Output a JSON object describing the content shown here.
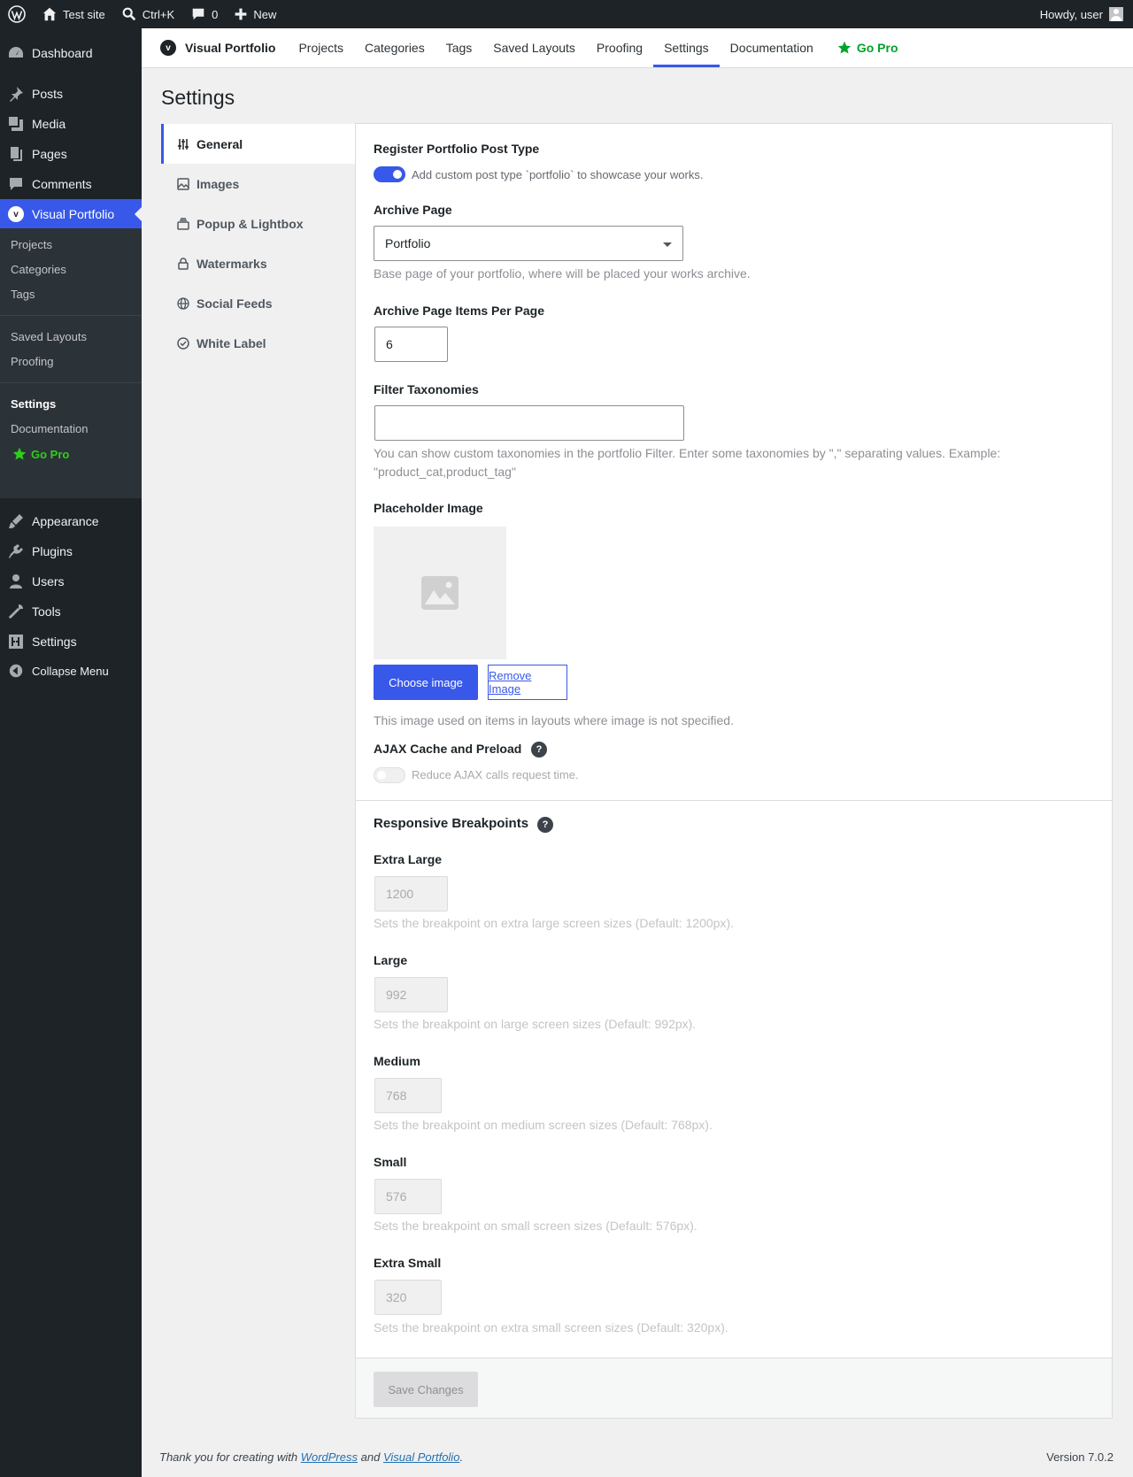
{
  "adminbar": {
    "site_name": "Test site",
    "search_shortcut": "Ctrl+K",
    "comments_count": "0",
    "new_label": "New",
    "howdy": "Howdy, user"
  },
  "menu": {
    "dashboard": "Dashboard",
    "posts": "Posts",
    "media": "Media",
    "pages": "Pages",
    "comments": "Comments",
    "visual_portfolio": "Visual Portfolio",
    "appearance": "Appearance",
    "plugins": "Plugins",
    "users": "Users",
    "tools": "Tools",
    "settings": "Settings",
    "collapse": "Collapse Menu",
    "submenu": {
      "projects": "Projects",
      "categories": "Categories",
      "tags": "Tags",
      "saved_layouts": "Saved Layouts",
      "proofing": "Proofing",
      "settings": "Settings",
      "documentation": "Documentation",
      "go_pro": "Go Pro"
    }
  },
  "header": {
    "brand": "Visual Portfolio",
    "logo_letter": "v",
    "nav": {
      "projects": "Projects",
      "categories": "Categories",
      "tags": "Tags",
      "saved_layouts": "Saved Layouts",
      "proofing": "Proofing",
      "settings": "Settings",
      "documentation": "Documentation",
      "go_pro": "Go Pro"
    }
  },
  "page": {
    "title": "Settings"
  },
  "tabs": {
    "general": "General",
    "images": "Images",
    "popup": "Popup & Lightbox",
    "watermarks": "Watermarks",
    "social": "Social Feeds",
    "white_label": "White Label"
  },
  "general": {
    "register_label": "Register Portfolio Post Type",
    "register_desc": "Add custom post type `portfolio` to showcase your works.",
    "register_enabled": true,
    "archive_label": "Archive Page",
    "archive_value": "Portfolio",
    "archive_desc": "Base page of your portfolio, where will be placed your works archive.",
    "per_page_label": "Archive Page Items Per Page",
    "per_page_value": "6",
    "filter_label": "Filter Taxonomies",
    "filter_value": "",
    "filter_desc_line1": "You can show custom taxonomies in the portfolio Filter. Enter some taxonomies by \",\" separating values. Example:",
    "filter_desc_line2": "\"product_cat,product_tag\"",
    "placeholder_label": "Placeholder Image",
    "choose_image": "Choose image",
    "remove_image": "Remove Image",
    "placeholder_desc": "This image used on items in layouts where image is not specified.",
    "ajax_label": "AJAX Cache and Preload",
    "ajax_desc": "Reduce AJAX calls request time.",
    "ajax_enabled": false,
    "help_glyph": "?"
  },
  "breakpoints": {
    "title": "Responsive Breakpoints",
    "xl_label": "Extra Large",
    "xl_value": "1200",
    "xl_desc": "Sets the breakpoint on extra large screen sizes (Default: 1200px).",
    "lg_label": "Large",
    "lg_value": "992",
    "lg_desc": "Sets the breakpoint on large screen sizes (Default: 992px).",
    "md_label": "Medium",
    "md_value": "768",
    "md_desc": "Sets the breakpoint on medium screen sizes (Default: 768px).",
    "sm_label": "Small",
    "sm_value": "576",
    "sm_desc": "Sets the breakpoint on small screen sizes (Default: 576px).",
    "xs_label": "Extra Small",
    "xs_value": "320",
    "xs_desc": "Sets the breakpoint on extra small screen sizes (Default: 320px)."
  },
  "save_button": "Save Changes",
  "footer": {
    "thanks_prefix": "Thank you for creating with",
    "wordpress": "WordPress",
    "and": "and",
    "visual_portfolio": "Visual Portfolio",
    "period": ".",
    "version": "Version 7.0.2"
  },
  "colors": {
    "accent": "#3858e9",
    "gopro": "#00a32a",
    "adminbar": "#1d2327"
  }
}
